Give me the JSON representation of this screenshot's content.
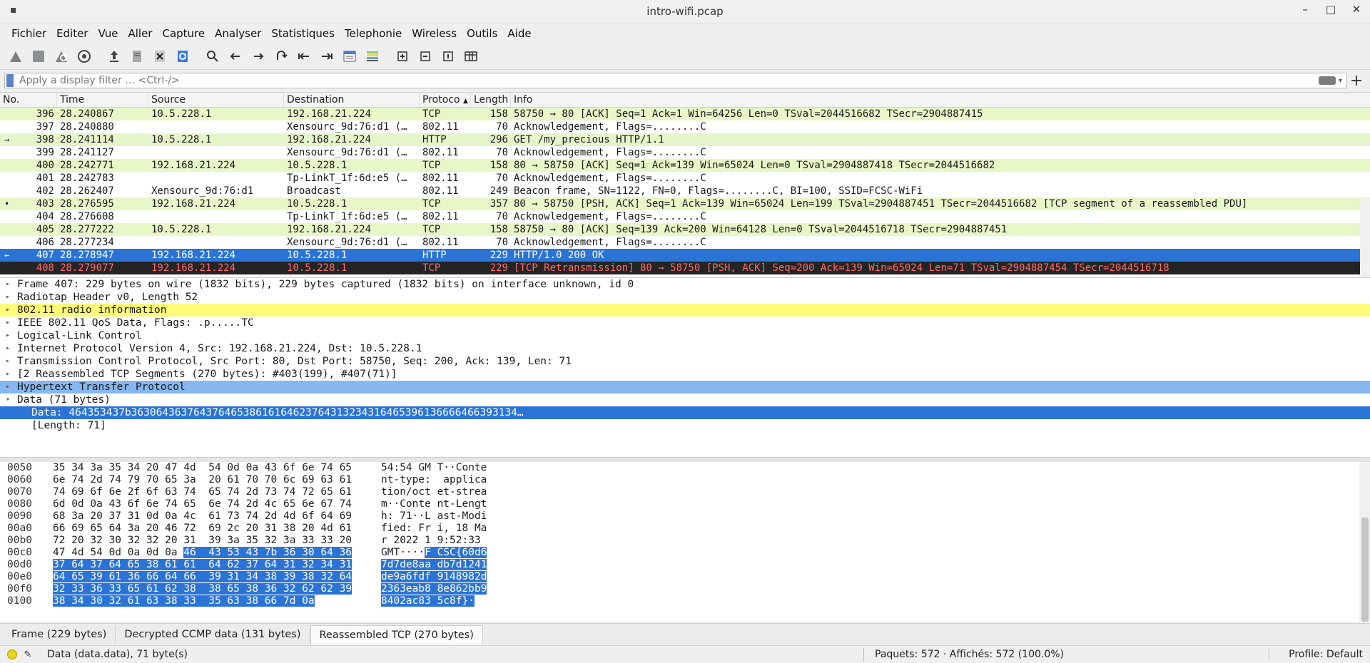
{
  "window": {
    "title": "intro-wifi.pcap",
    "controls": [
      "–",
      "□",
      "✕"
    ]
  },
  "menubar": [
    "Fichier",
    "Editer",
    "Vue",
    "Aller",
    "Capture",
    "Analyser",
    "Statistiques",
    "Telephonie",
    "Wireless",
    "Outils",
    "Aide"
  ],
  "filter": {
    "placeholder": "Apply a display filter … <Ctrl-/>"
  },
  "columns": {
    "no": "No.",
    "time": "Time",
    "source": "Source",
    "destination": "Destination",
    "protocol": "Protoco",
    "sort_glyph": "▲",
    "length": "Length",
    "info": "Info"
  },
  "packets": [
    {
      "no": "396",
      "time": "28.240867",
      "src": "10.5.228.1",
      "dst": "192.168.21.224",
      "proto": "TCP",
      "len": "158",
      "info": "58750 → 80 [ACK] Seq=1 Ack=1 Win=64256 Len=0 TSval=2044516682 TSecr=2904887415",
      "style": "tcp",
      "mark": ""
    },
    {
      "no": "397",
      "time": "28.240880",
      "src": "",
      "dst": "Xensourc_9d:76:d1 (…",
      "proto": "802.11",
      "len": "70",
      "info": "Acknowledgement, Flags=........C",
      "style": "wlan",
      "mark": ""
    },
    {
      "no": "398",
      "time": "28.241114",
      "src": "10.5.228.1",
      "dst": "192.168.21.224",
      "proto": "HTTP",
      "len": "296",
      "info": "GET /my_precious HTTP/1.1",
      "style": "http",
      "mark": "→"
    },
    {
      "no": "399",
      "time": "28.241127",
      "src": "",
      "dst": "Xensourc_9d:76:d1 (…",
      "proto": "802.11",
      "len": "70",
      "info": "Acknowledgement, Flags=........C",
      "style": "wlan",
      "mark": ""
    },
    {
      "no": "400",
      "time": "28.242771",
      "src": "192.168.21.224",
      "dst": "10.5.228.1",
      "proto": "TCP",
      "len": "158",
      "info": "80 → 58750 [ACK] Seq=1 Ack=139 Win=65024 Len=0 TSval=2904887418 TSecr=2044516682",
      "style": "tcp",
      "mark": ""
    },
    {
      "no": "401",
      "time": "28.242783",
      "src": "",
      "dst": "Tp-LinkT_1f:6d:e5 (…",
      "proto": "802.11",
      "len": "70",
      "info": "Acknowledgement, Flags=........C",
      "style": "wlan",
      "mark": ""
    },
    {
      "no": "402",
      "time": "28.262407",
      "src": "Xensourc_9d:76:d1",
      "dst": "Broadcast",
      "proto": "802.11",
      "len": "249",
      "info": "Beacon frame, SN=1122, FN=0, Flags=........C, BI=100, SSID=FCSC-WiFi",
      "style": "wlan",
      "mark": ""
    },
    {
      "no": "403",
      "time": "28.276595",
      "src": "192.168.21.224",
      "dst": "10.5.228.1",
      "proto": "TCP",
      "len": "357",
      "info": "80 → 58750 [PSH, ACK] Seq=1 Ack=139 Win=65024 Len=199 TSval=2904887451 TSecr=2044516682 [TCP segment of a reassembled PDU]",
      "style": "tcp",
      "mark": "•"
    },
    {
      "no": "404",
      "time": "28.276608",
      "src": "",
      "dst": "Tp-LinkT_1f:6d:e5 (…",
      "proto": "802.11",
      "len": "70",
      "info": "Acknowledgement, Flags=........C",
      "style": "wlan",
      "mark": ""
    },
    {
      "no": "405",
      "time": "28.277222",
      "src": "10.5.228.1",
      "dst": "192.168.21.224",
      "proto": "TCP",
      "len": "158",
      "info": "58750 → 80 [ACK] Seq=139 Ack=200 Win=64128 Len=0 TSval=2044516718 TSecr=2904887451",
      "style": "tcp",
      "mark": ""
    },
    {
      "no": "406",
      "time": "28.277234",
      "src": "",
      "dst": "Xensourc_9d:76:d1 (…",
      "proto": "802.11",
      "len": "70",
      "info": "Acknowledgement, Flags=........C",
      "style": "wlan",
      "mark": ""
    },
    {
      "no": "407",
      "time": "28.278947",
      "src": "192.168.21.224",
      "dst": "10.5.228.1",
      "proto": "HTTP",
      "len": "229",
      "info": "HTTP/1.0 200 OK",
      "style": "sel",
      "mark": "←"
    },
    {
      "no": "408",
      "time": "28.279077",
      "src": "192.168.21.224",
      "dst": "10.5.228.1",
      "proto": "TCP",
      "len": "229",
      "info": "[TCP Retransmission] 80 → 58750 [PSH, ACK] Seq=200 Ack=139 Win=65024 Len=71 TSval=2904887454 TSecr=2044516718",
      "style": "err",
      "mark": ""
    }
  ],
  "details": [
    {
      "text": "Frame 407: 229 bytes on wire (1832 bits), 229 bytes captured (1832 bits) on interface unknown, id 0",
      "style": "",
      "arrow": "▸"
    },
    {
      "text": "Radiotap Header v0, Length 52",
      "style": "",
      "arrow": "▸"
    },
    {
      "text": "802.11 radio information",
      "style": "yellow",
      "arrow": "▸"
    },
    {
      "text": "IEEE 802.11 QoS Data, Flags: .p.....TC",
      "style": "",
      "arrow": "▸"
    },
    {
      "text": "Logical-Link Control",
      "style": "",
      "arrow": "▸"
    },
    {
      "text": "Internet Protocol Version 4, Src: 192.168.21.224, Dst: 10.5.228.1",
      "style": "",
      "arrow": "▸"
    },
    {
      "text": "Transmission Control Protocol, Src Port: 80, Dst Port: 58750, Seq: 200, Ack: 139, Len: 71",
      "style": "",
      "arrow": "▸"
    },
    {
      "text": "[2 Reassembled TCP Segments (270 bytes): #403(199), #407(71)]",
      "style": "",
      "arrow": "▸"
    },
    {
      "text": "Hypertext Transfer Protocol",
      "style": "bluel",
      "arrow": "▸"
    },
    {
      "text": "Data (71 bytes)",
      "style": "",
      "arrow": "▾"
    },
    {
      "text": "Data: 464353437b36306436376437646538616164623764313234316465396136666466393134…",
      "style": "sel",
      "arrow": ""
    },
    {
      "text": "[Length: 71]",
      "style": "child",
      "arrow": ""
    }
  ],
  "hex": [
    {
      "off": "0050",
      "bytes": "35 34 3a 35 34 20 47 4d  54 0d 0a 43 6f 6e 74 65",
      "ascii": "54:54 GM T··Conte",
      "hl_from": -1
    },
    {
      "off": "0060",
      "bytes": "6e 74 2d 74 79 70 65 3a  20 61 70 70 6c 69 63 61",
      "ascii": "nt-type:  applica",
      "hl_from": -1
    },
    {
      "off": "0070",
      "bytes": "74 69 6f 6e 2f 6f 63 74  65 74 2d 73 74 72 65 61",
      "ascii": "tion/oct et-strea",
      "hl_from": -1
    },
    {
      "off": "0080",
      "bytes": "6d 0d 0a 43 6f 6e 74 65  6e 74 2d 4c 65 6e 67 74",
      "ascii": "m··Conte nt-Lengt",
      "hl_from": -1
    },
    {
      "off": "0090",
      "bytes": "68 3a 20 37 31 0d 0a 4c  61 73 74 2d 4d 6f 64 69",
      "ascii": "h: 71··L ast-Modi",
      "hl_from": -1
    },
    {
      "off": "00a0",
      "bytes": "66 69 65 64 3a 20 46 72  69 2c 20 31 38 20 4d 61",
      "ascii": "fied: Fr i, 18 Ma",
      "hl_from": -1
    },
    {
      "off": "00b0",
      "bytes": "72 20 32 30 32 32 20 31  39 3a 35 32 3a 33 33 20",
      "ascii": "r 2022 1 9:52:33 ",
      "hl_from": -1
    },
    {
      "off": "00c0",
      "bytes_a": "47 4d 54 0d 0a 0d 0a ",
      "bytes_b": "46  43 53 43 7b 36 30 64 36",
      "ascii_a": "GMT····",
      "ascii_b": "F CSC{60d6",
      "hl_from": 1
    },
    {
      "off": "00d0",
      "bytes": "37 64 37 64 65 38 61 61  64 62 37 64 31 32 34 31",
      "ascii": "7d7de8aa db7d1241",
      "hl_from": 0
    },
    {
      "off": "00e0",
      "bytes": "64 65 39 61 36 66 64 66  39 31 34 38 39 38 32 64",
      "ascii": "de9a6fdf 9148982d",
      "hl_from": 0
    },
    {
      "off": "00f0",
      "bytes": "32 33 36 33 65 61 62 38  38 65 38 36 32 62 62 39",
      "ascii": "2363eab8 8e862bb9",
      "hl_from": 0
    },
    {
      "off": "0100",
      "bytes": "38 34 30 32 61 63 38 33  35 63 38 66 7d 0a",
      "ascii": "8402ac83 5c8f}·",
      "hl_from": 0
    }
  ],
  "tabs": [
    "Frame (229 bytes)",
    "Decrypted CCMP data (131 bytes)",
    "Reassembled TCP (270 bytes)"
  ],
  "status": {
    "field": "Data (data.data), 71 byte(s)",
    "packets": "Paquets: 572 · Affichés: 572 (100.0%)",
    "profile": "Profile: Default"
  },
  "colors": {
    "tcp_row": "#e7f7c8",
    "selected": "#2b74d6",
    "error_bg": "#242424",
    "error_fg": "#ff6b6b",
    "radio_info": "#fefb7a",
    "http_tree": "#86b7ee"
  }
}
